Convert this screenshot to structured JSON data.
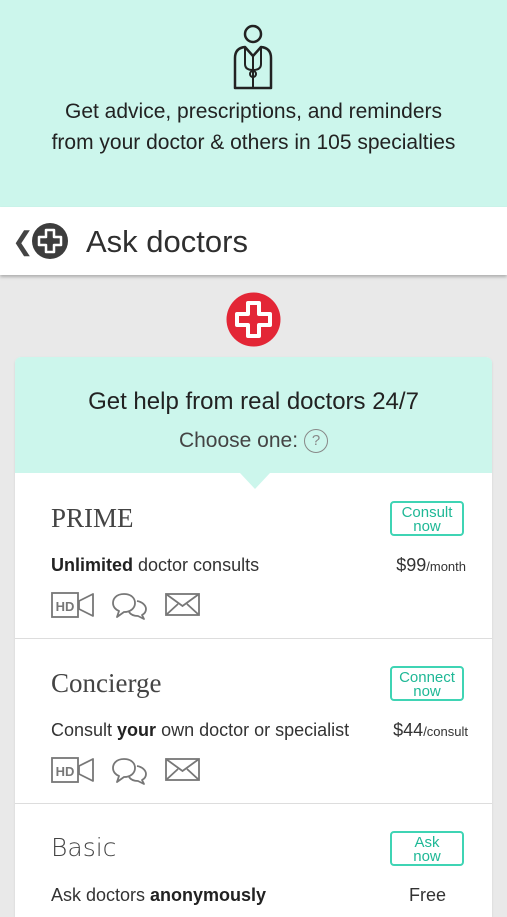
{
  "banner": {
    "line1": "Get advice, prescriptions, and reminders",
    "line2": "from your doctor & others in 105 specialties"
  },
  "appbar": {
    "back_icon": "chevron-left-icon",
    "title": "Ask doctors"
  },
  "card": {
    "title": "Get help from real doctors 24/7",
    "subtitle": "Choose one:",
    "help_symbol": "?"
  },
  "plans": [
    {
      "name": "PRIME",
      "button_line1": "Consult",
      "button_line2": "now",
      "desc_bold_first": "Unlimited",
      "desc_rest": " doctor consults",
      "price": "$99",
      "price_unit": "/month"
    },
    {
      "name": "Concierge",
      "button_line1": "Connect",
      "button_line2": "now",
      "desc_pre": "Consult ",
      "desc_bold": "your",
      "desc_post": " own doctor or specialist",
      "price": "$44",
      "price_unit": "/consult"
    },
    {
      "name": "Basic",
      "button_line1": "Ask",
      "button_line2": "now",
      "desc_pre": "Ask doctors ",
      "desc_bold": "anonymously",
      "price": "Free"
    }
  ],
  "colors": {
    "mint": "#ccf6ec",
    "accent": "#3fd4b4",
    "brand_red": "#e32636"
  }
}
